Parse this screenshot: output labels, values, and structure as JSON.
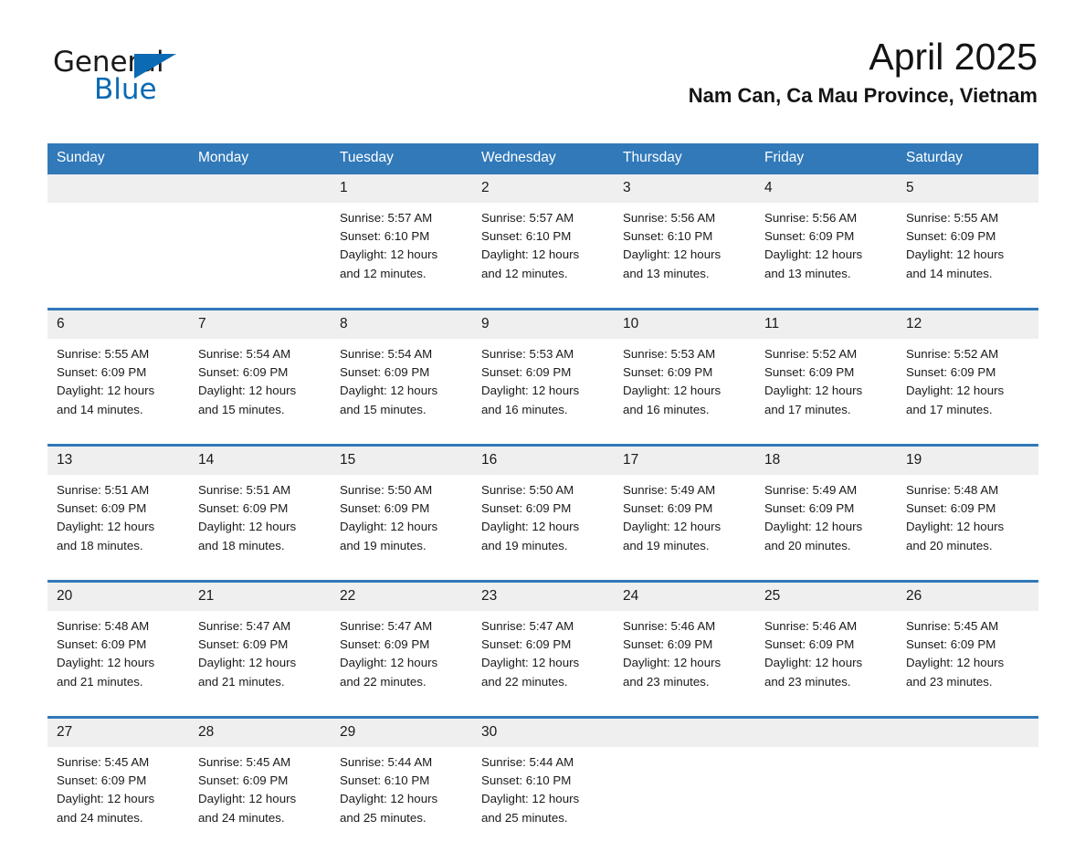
{
  "brand": {
    "name_part1": "General",
    "name_part2": "Blue",
    "triangle_color": "#0a6ab4",
    "accent_color": "#3179b9"
  },
  "header": {
    "title": "April 2025",
    "subtitle": "Nam Can, Ca Mau Province, Vietnam"
  },
  "calendar": {
    "day_headers": [
      "Sunday",
      "Monday",
      "Tuesday",
      "Wednesday",
      "Thursday",
      "Friday",
      "Saturday"
    ],
    "weeks": [
      {
        "days": [
          {
            "date": "",
            "sunrise": "",
            "sunset": "",
            "daylight_line1": "",
            "daylight_line2": ""
          },
          {
            "date": "",
            "sunrise": "",
            "sunset": "",
            "daylight_line1": "",
            "daylight_line2": ""
          },
          {
            "date": "1",
            "sunrise": "Sunrise: 5:57 AM",
            "sunset": "Sunset: 6:10 PM",
            "daylight_line1": "Daylight: 12 hours",
            "daylight_line2": "and 12 minutes."
          },
          {
            "date": "2",
            "sunrise": "Sunrise: 5:57 AM",
            "sunset": "Sunset: 6:10 PM",
            "daylight_line1": "Daylight: 12 hours",
            "daylight_line2": "and 12 minutes."
          },
          {
            "date": "3",
            "sunrise": "Sunrise: 5:56 AM",
            "sunset": "Sunset: 6:10 PM",
            "daylight_line1": "Daylight: 12 hours",
            "daylight_line2": "and 13 minutes."
          },
          {
            "date": "4",
            "sunrise": "Sunrise: 5:56 AM",
            "sunset": "Sunset: 6:09 PM",
            "daylight_line1": "Daylight: 12 hours",
            "daylight_line2": "and 13 minutes."
          },
          {
            "date": "5",
            "sunrise": "Sunrise: 5:55 AM",
            "sunset": "Sunset: 6:09 PM",
            "daylight_line1": "Daylight: 12 hours",
            "daylight_line2": "and 14 minutes."
          }
        ]
      },
      {
        "days": [
          {
            "date": "6",
            "sunrise": "Sunrise: 5:55 AM",
            "sunset": "Sunset: 6:09 PM",
            "daylight_line1": "Daylight: 12 hours",
            "daylight_line2": "and 14 minutes."
          },
          {
            "date": "7",
            "sunrise": "Sunrise: 5:54 AM",
            "sunset": "Sunset: 6:09 PM",
            "daylight_line1": "Daylight: 12 hours",
            "daylight_line2": "and 15 minutes."
          },
          {
            "date": "8",
            "sunrise": "Sunrise: 5:54 AM",
            "sunset": "Sunset: 6:09 PM",
            "daylight_line1": "Daylight: 12 hours",
            "daylight_line2": "and 15 minutes."
          },
          {
            "date": "9",
            "sunrise": "Sunrise: 5:53 AM",
            "sunset": "Sunset: 6:09 PM",
            "daylight_line1": "Daylight: 12 hours",
            "daylight_line2": "and 16 minutes."
          },
          {
            "date": "10",
            "sunrise": "Sunrise: 5:53 AM",
            "sunset": "Sunset: 6:09 PM",
            "daylight_line1": "Daylight: 12 hours",
            "daylight_line2": "and 16 minutes."
          },
          {
            "date": "11",
            "sunrise": "Sunrise: 5:52 AM",
            "sunset": "Sunset: 6:09 PM",
            "daylight_line1": "Daylight: 12 hours",
            "daylight_line2": "and 17 minutes."
          },
          {
            "date": "12",
            "sunrise": "Sunrise: 5:52 AM",
            "sunset": "Sunset: 6:09 PM",
            "daylight_line1": "Daylight: 12 hours",
            "daylight_line2": "and 17 minutes."
          }
        ]
      },
      {
        "days": [
          {
            "date": "13",
            "sunrise": "Sunrise: 5:51 AM",
            "sunset": "Sunset: 6:09 PM",
            "daylight_line1": "Daylight: 12 hours",
            "daylight_line2": "and 18 minutes."
          },
          {
            "date": "14",
            "sunrise": "Sunrise: 5:51 AM",
            "sunset": "Sunset: 6:09 PM",
            "daylight_line1": "Daylight: 12 hours",
            "daylight_line2": "and 18 minutes."
          },
          {
            "date": "15",
            "sunrise": "Sunrise: 5:50 AM",
            "sunset": "Sunset: 6:09 PM",
            "daylight_line1": "Daylight: 12 hours",
            "daylight_line2": "and 19 minutes."
          },
          {
            "date": "16",
            "sunrise": "Sunrise: 5:50 AM",
            "sunset": "Sunset: 6:09 PM",
            "daylight_line1": "Daylight: 12 hours",
            "daylight_line2": "and 19 minutes."
          },
          {
            "date": "17",
            "sunrise": "Sunrise: 5:49 AM",
            "sunset": "Sunset: 6:09 PM",
            "daylight_line1": "Daylight: 12 hours",
            "daylight_line2": "and 19 minutes."
          },
          {
            "date": "18",
            "sunrise": "Sunrise: 5:49 AM",
            "sunset": "Sunset: 6:09 PM",
            "daylight_line1": "Daylight: 12 hours",
            "daylight_line2": "and 20 minutes."
          },
          {
            "date": "19",
            "sunrise": "Sunrise: 5:48 AM",
            "sunset": "Sunset: 6:09 PM",
            "daylight_line1": "Daylight: 12 hours",
            "daylight_line2": "and 20 minutes."
          }
        ]
      },
      {
        "days": [
          {
            "date": "20",
            "sunrise": "Sunrise: 5:48 AM",
            "sunset": "Sunset: 6:09 PM",
            "daylight_line1": "Daylight: 12 hours",
            "daylight_line2": "and 21 minutes."
          },
          {
            "date": "21",
            "sunrise": "Sunrise: 5:47 AM",
            "sunset": "Sunset: 6:09 PM",
            "daylight_line1": "Daylight: 12 hours",
            "daylight_line2": "and 21 minutes."
          },
          {
            "date": "22",
            "sunrise": "Sunrise: 5:47 AM",
            "sunset": "Sunset: 6:09 PM",
            "daylight_line1": "Daylight: 12 hours",
            "daylight_line2": "and 22 minutes."
          },
          {
            "date": "23",
            "sunrise": "Sunrise: 5:47 AM",
            "sunset": "Sunset: 6:09 PM",
            "daylight_line1": "Daylight: 12 hours",
            "daylight_line2": "and 22 minutes."
          },
          {
            "date": "24",
            "sunrise": "Sunrise: 5:46 AM",
            "sunset": "Sunset: 6:09 PM",
            "daylight_line1": "Daylight: 12 hours",
            "daylight_line2": "and 23 minutes."
          },
          {
            "date": "25",
            "sunrise": "Sunrise: 5:46 AM",
            "sunset": "Sunset: 6:09 PM",
            "daylight_line1": "Daylight: 12 hours",
            "daylight_line2": "and 23 minutes."
          },
          {
            "date": "26",
            "sunrise": "Sunrise: 5:45 AM",
            "sunset": "Sunset: 6:09 PM",
            "daylight_line1": "Daylight: 12 hours",
            "daylight_line2": "and 23 minutes."
          }
        ]
      },
      {
        "days": [
          {
            "date": "27",
            "sunrise": "Sunrise: 5:45 AM",
            "sunset": "Sunset: 6:09 PM",
            "daylight_line1": "Daylight: 12 hours",
            "daylight_line2": "and 24 minutes."
          },
          {
            "date": "28",
            "sunrise": "Sunrise: 5:45 AM",
            "sunset": "Sunset: 6:09 PM",
            "daylight_line1": "Daylight: 12 hours",
            "daylight_line2": "and 24 minutes."
          },
          {
            "date": "29",
            "sunrise": "Sunrise: 5:44 AM",
            "sunset": "Sunset: 6:10 PM",
            "daylight_line1": "Daylight: 12 hours",
            "daylight_line2": "and 25 minutes."
          },
          {
            "date": "30",
            "sunrise": "Sunrise: 5:44 AM",
            "sunset": "Sunset: 6:10 PM",
            "daylight_line1": "Daylight: 12 hours",
            "daylight_line2": "and 25 minutes."
          },
          {
            "date": "",
            "sunrise": "",
            "sunset": "",
            "daylight_line1": "",
            "daylight_line2": ""
          },
          {
            "date": "",
            "sunrise": "",
            "sunset": "",
            "daylight_line1": "",
            "daylight_line2": ""
          },
          {
            "date": "",
            "sunrise": "",
            "sunset": "",
            "daylight_line1": "",
            "daylight_line2": ""
          }
        ]
      }
    ]
  }
}
